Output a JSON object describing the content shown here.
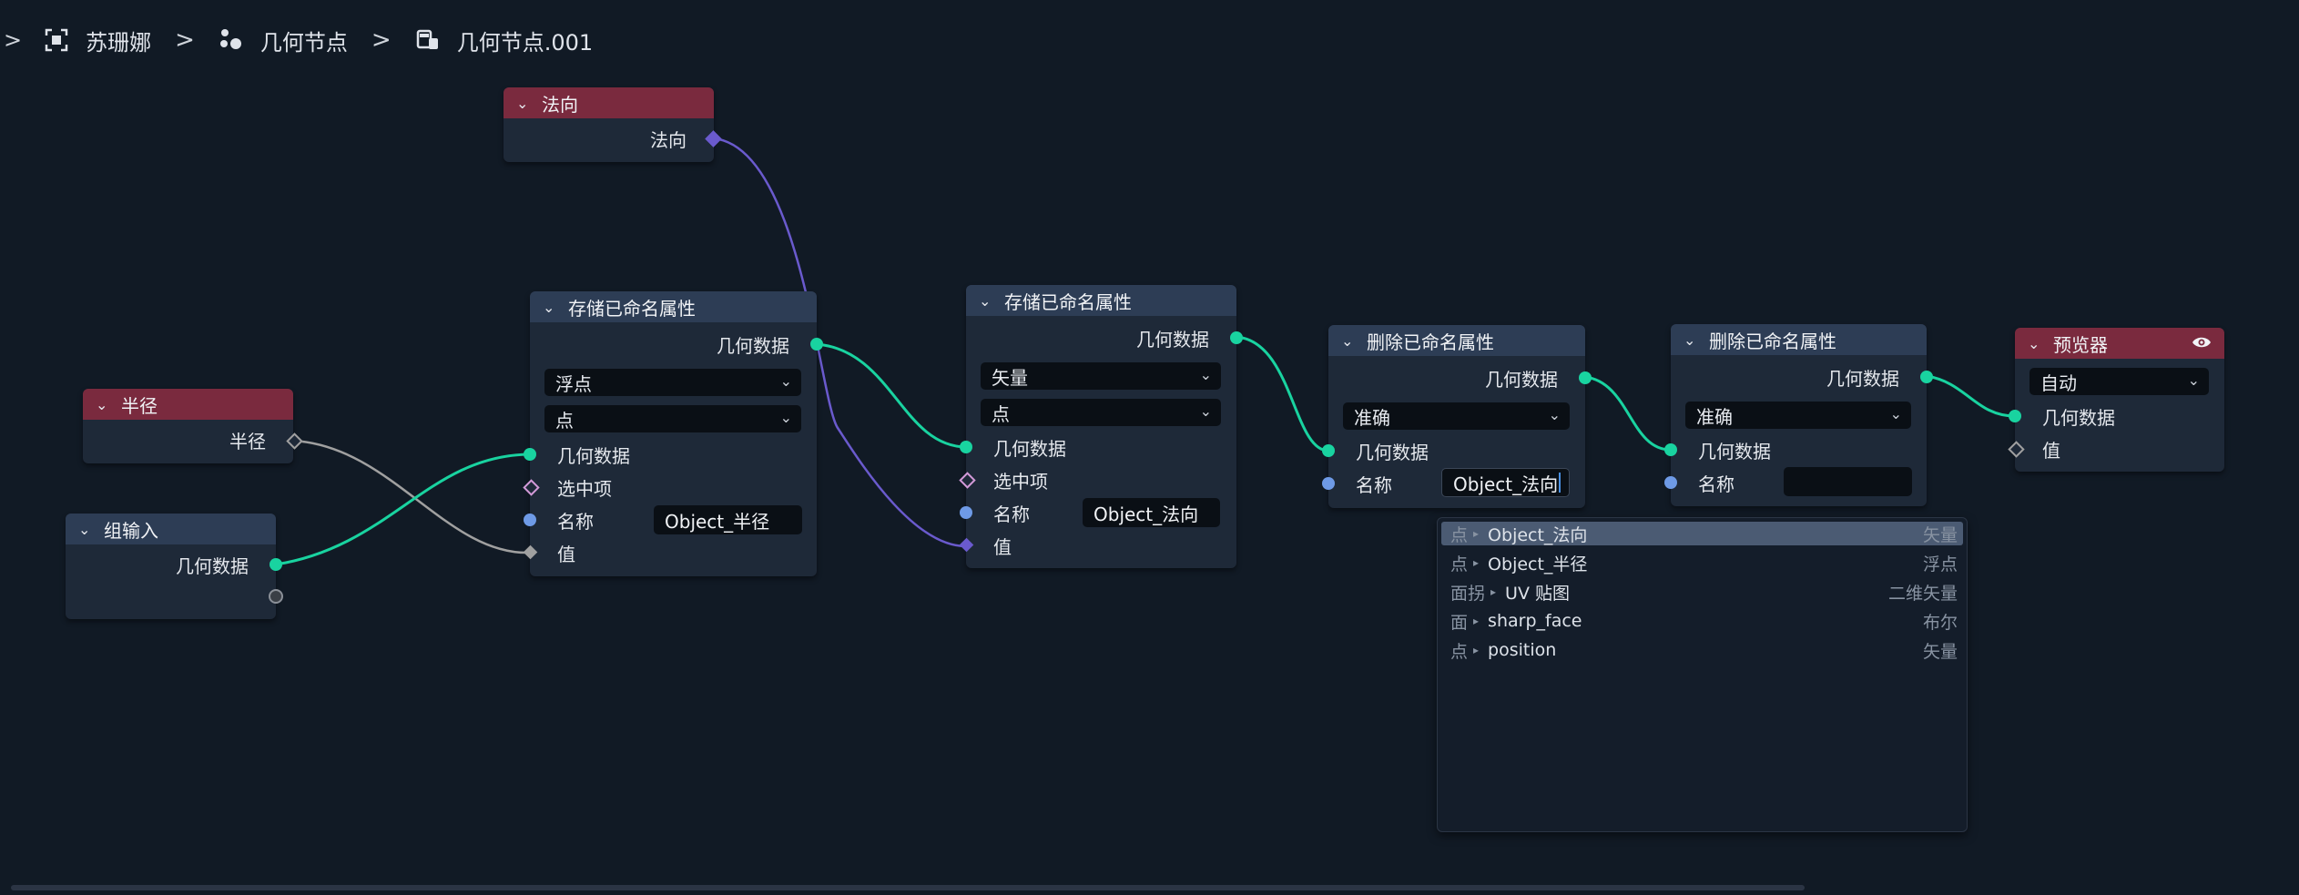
{
  "breadcrumb": {
    "items": [
      {
        "label": "苏珊娜",
        "icon": "object-icon"
      },
      {
        "label": "几何节点",
        "icon": "geometry-nodes-icon"
      },
      {
        "label": "几何节点.001",
        "icon": "node-tree-icon"
      }
    ]
  },
  "nodes": {
    "normal": {
      "title": "法向",
      "out_label": "法向"
    },
    "radius": {
      "title": "半径",
      "out_label": "半径"
    },
    "group_input": {
      "title": "组输入",
      "out_label": "几何数据"
    },
    "store1": {
      "title": "存储已命名属性",
      "out_label": "几何数据",
      "data_type": "浮点",
      "domain": "点",
      "in_geometry": "几何数据",
      "in_selection": "选中项",
      "in_name": "名称",
      "name_value": "Object_半径",
      "in_value": "值"
    },
    "store2": {
      "title": "存储已命名属性",
      "out_label": "几何数据",
      "data_type": "矢量",
      "domain": "点",
      "in_geometry": "几何数据",
      "in_selection": "选中项",
      "in_name": "名称",
      "name_value": "Object_法向",
      "in_value": "值"
    },
    "remove1": {
      "title": "删除已命名属性",
      "out_label": "几何数据",
      "mode": "准确",
      "in_geometry": "几何数据",
      "in_name": "名称",
      "name_value": "Object_法向"
    },
    "remove2": {
      "title": "删除已命名属性",
      "out_label": "几何数据",
      "mode": "准确",
      "in_geometry": "几何数据",
      "in_name": "名称",
      "name_value": ""
    },
    "viewer": {
      "title": "预览器",
      "mode": "自动",
      "in_geometry": "几何数据",
      "in_value": "值"
    }
  },
  "attribute_dropdown": {
    "items": [
      {
        "domain": "点",
        "name": "Object_法向",
        "type": "矢量",
        "active": true
      },
      {
        "domain": "点",
        "name": "Object_半径",
        "type": "浮点",
        "active": false
      },
      {
        "domain": "面拐",
        "name": "UV 贴图",
        "type": "二维矢量",
        "active": false
      },
      {
        "domain": "面",
        "name": "sharp_face",
        "type": "布尔",
        "active": false
      },
      {
        "domain": "点",
        "name": "position",
        "type": "矢量",
        "active": false
      }
    ]
  },
  "colors": {
    "background": "#111a25",
    "node_body": "#1e2938",
    "header_blue": "#2d3d55",
    "header_red": "#7a2a3e",
    "geometry_socket": "#19d3a0",
    "vector_link": "#6a5acd",
    "float_link": "#a0a0a0",
    "string_socket": "#6e9ae6"
  }
}
